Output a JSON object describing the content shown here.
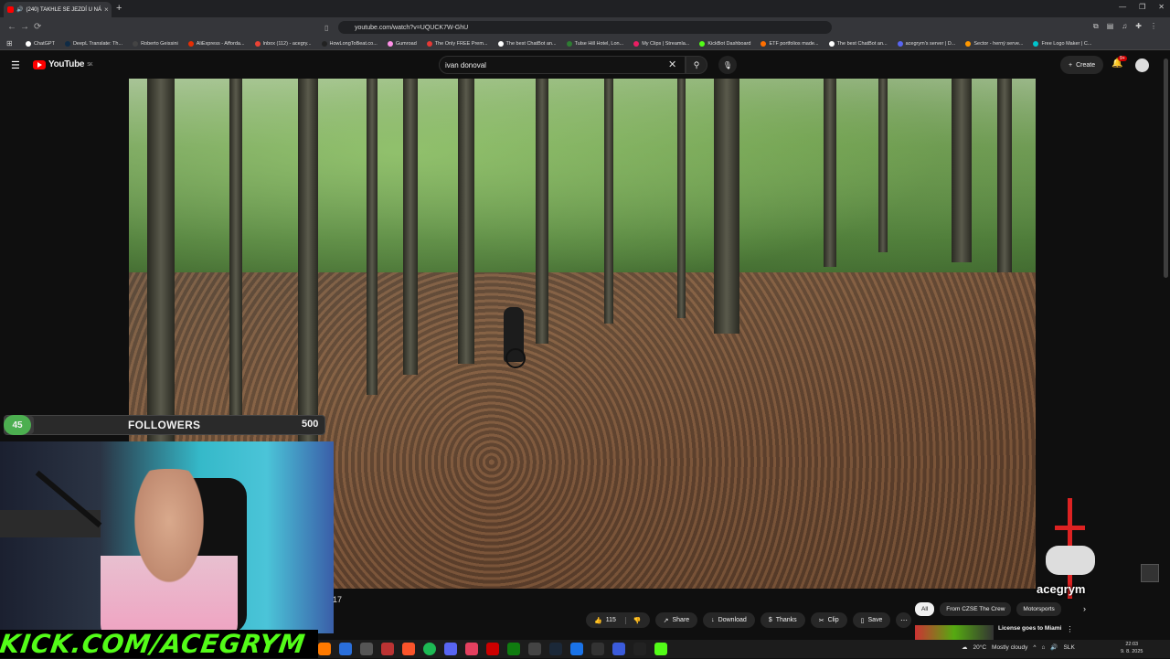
{
  "browser": {
    "tab_title": "(240) TAKHLE SE JEZDÍ U NÁ",
    "new_tab": "+",
    "url": "youtube.com/watch?v=UQUCK7W-GhU",
    "bookmarks": [
      {
        "label": "ChatGPT",
        "color": "#ffffff"
      },
      {
        "label": "DeepL Translate: Th...",
        "color": "#0f2b46"
      },
      {
        "label": "Roberto Geissini",
        "color": "#444444"
      },
      {
        "label": "AliExpress - Afforda...",
        "color": "#e62e04"
      },
      {
        "label": "Inbox (112) - acegry...",
        "color": "#ea4335"
      },
      {
        "label": "HowLongToBeat.co...",
        "color": "#222222"
      },
      {
        "label": "Gumroad",
        "color": "#ff90e8"
      },
      {
        "label": "The Only FREE Prem...",
        "color": "#e53935"
      },
      {
        "label": "The best ChatBot an...",
        "color": "#ffffff"
      },
      {
        "label": "Tulse Hill Hotel, Lon...",
        "color": "#2e7d32"
      },
      {
        "label": "My Clips | Streamla...",
        "color": "#e91e63"
      },
      {
        "label": "KickBot Dashboard",
        "color": "#53fc18"
      },
      {
        "label": "ETF portfolios made...",
        "color": "#ff6f00"
      },
      {
        "label": "The best ChatBot an...",
        "color": "#ffffff"
      },
      {
        "label": "acegrym's server | D...",
        "color": "#5865f2"
      },
      {
        "label": "Sector - herný serve...",
        "color": "#ff9800"
      },
      {
        "label": "Free Logo Maker | C...",
        "color": "#00c4cc"
      }
    ]
  },
  "youtube": {
    "logo_text": "YouTube",
    "region": "SK",
    "search_value": "ivan donoval",
    "create_label": "Create",
    "notification_count": "9+",
    "brand_color": "#ff0000"
  },
  "overlay": {
    "followers_current": "45",
    "followers_label": "FOLLOWERS",
    "followers_goal": "500",
    "followers_progress": 0.09,
    "timestamp": "17",
    "kick_banner": "KICK.COM/ACEGRYM",
    "logo_text": "acegrym"
  },
  "actions": {
    "likes": "115",
    "share": "Share",
    "download": "Download",
    "thanks": "Thanks",
    "clip": "Clip",
    "save": "Save"
  },
  "chips": [
    "All",
    "From CZSE The Crew",
    "Motorsports"
  ],
  "recommendation": {
    "title": "License goes to Miami"
  },
  "taskbar": {
    "weather": "20°C",
    "weather_desc": "Mostly cloudy",
    "language": "SLK",
    "time": "22:03",
    "date": "9. 8. 2025"
  }
}
